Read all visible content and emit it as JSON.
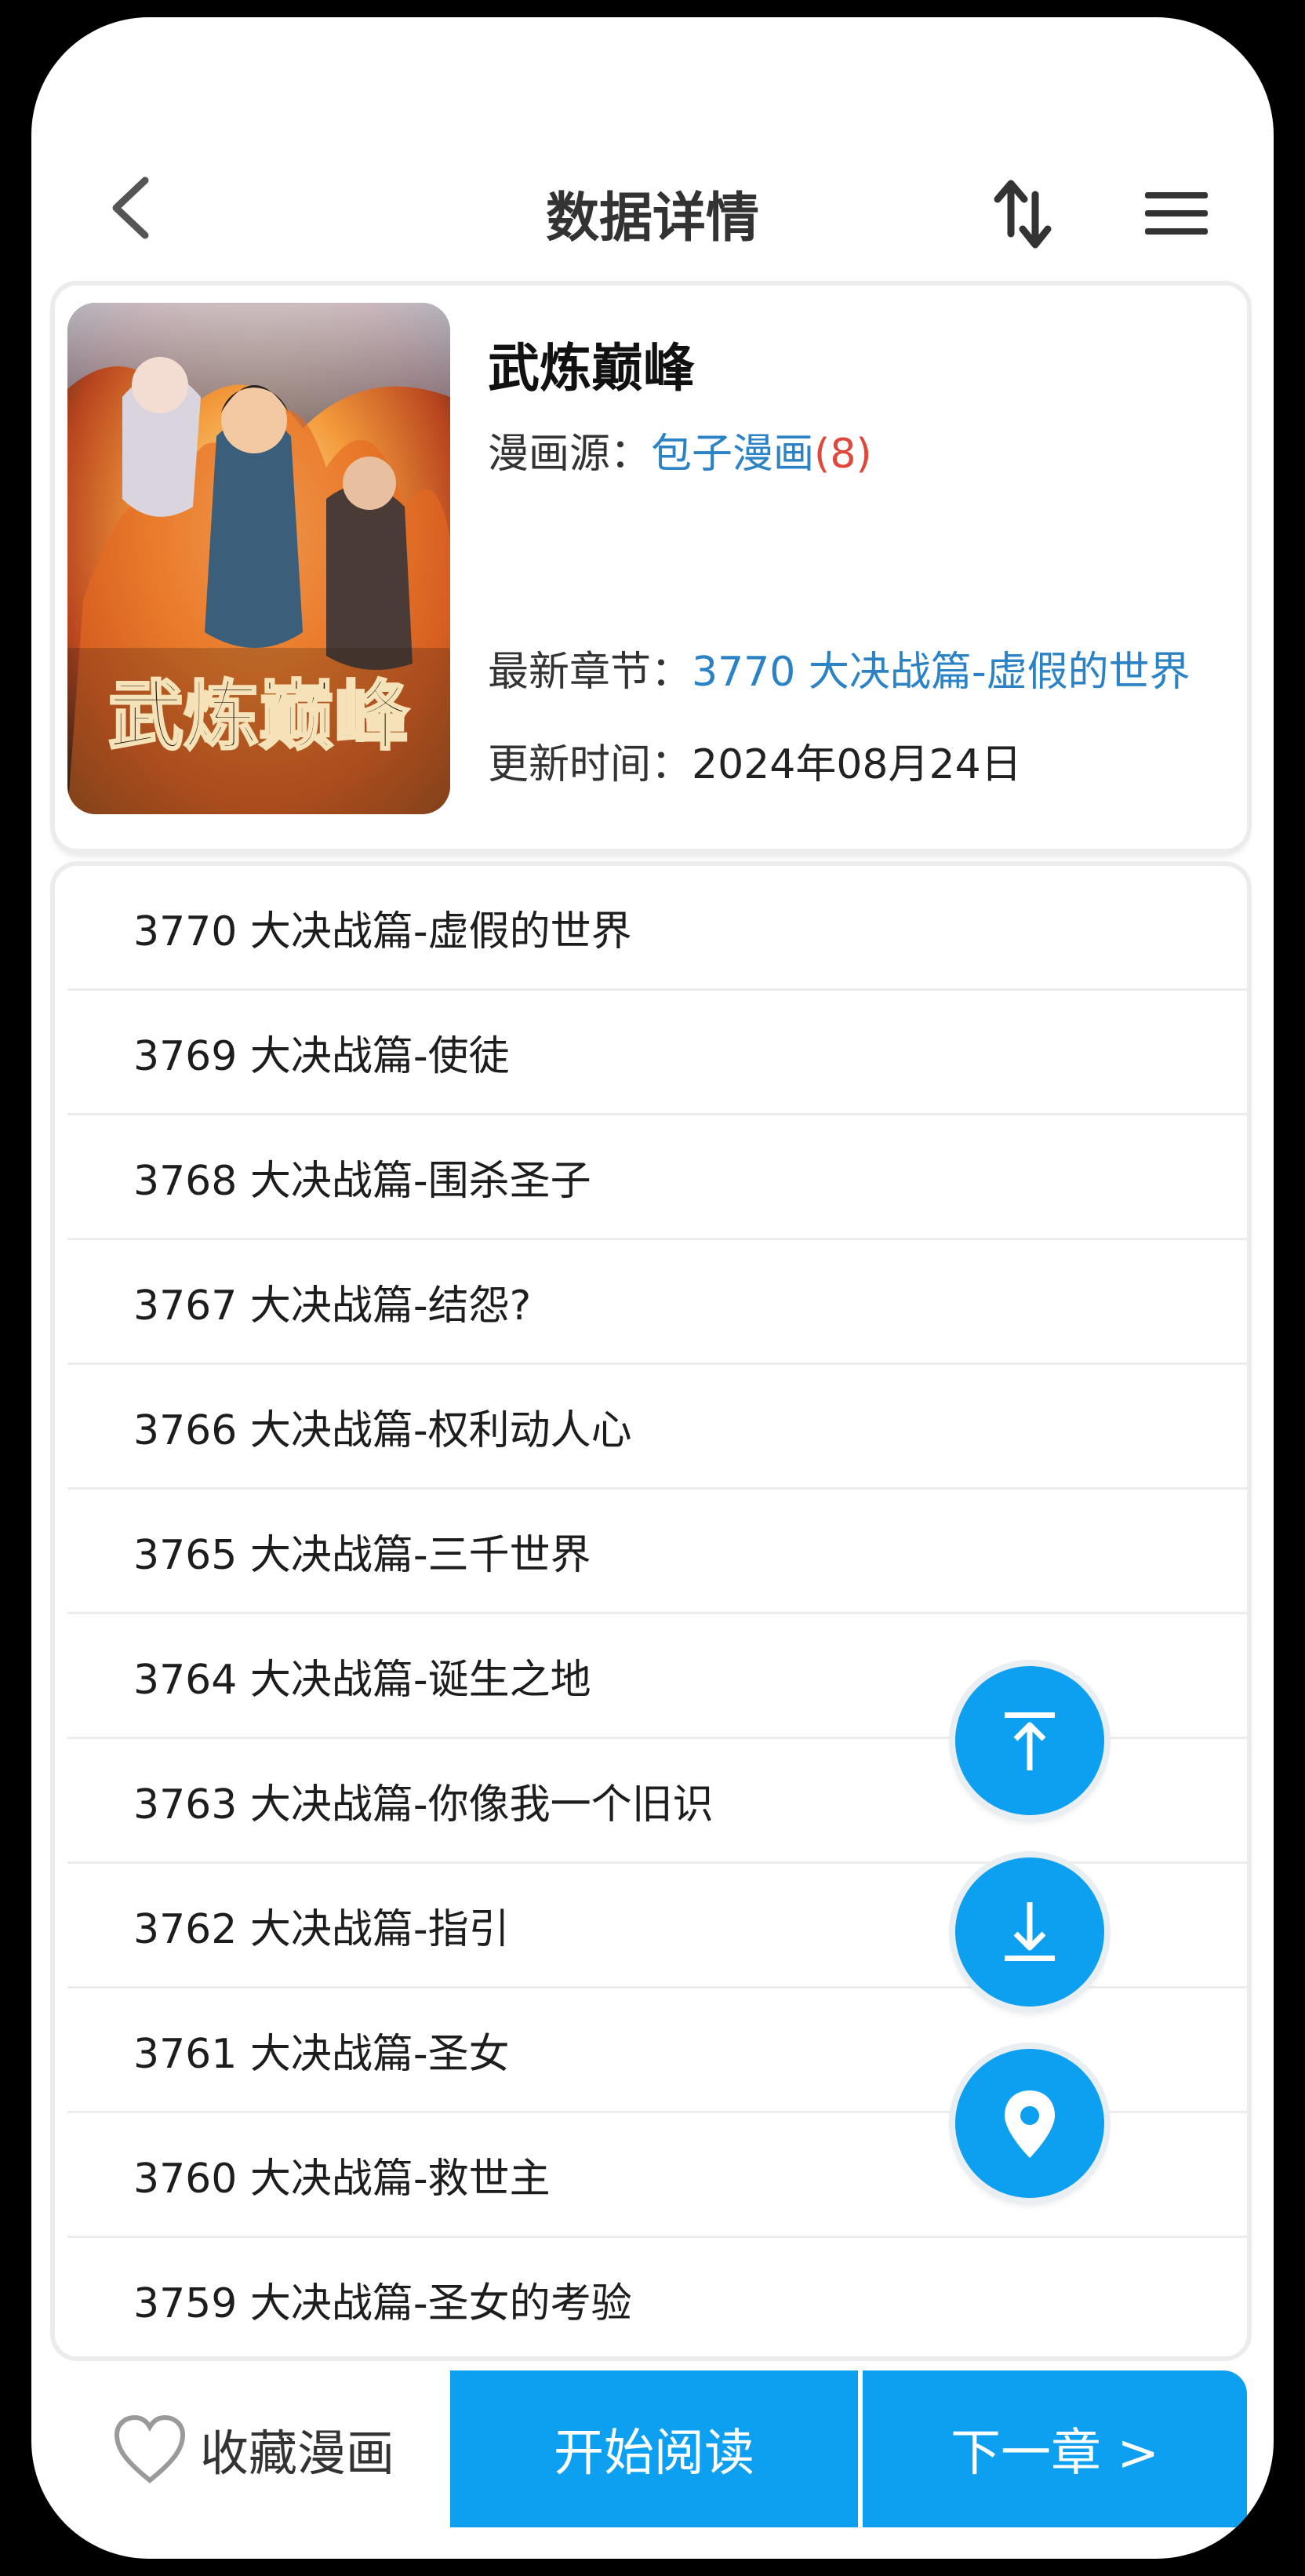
{
  "header": {
    "title": "数据详情",
    "back_icon": "chevron-left-icon",
    "sort_icon": "sort-arrows-icon",
    "menu_icon": "hamburger-menu-icon"
  },
  "info": {
    "name": "武炼巅峰",
    "cover_text": "武炼巅峰",
    "source_label": "漫画源：",
    "source_value": "包子漫画",
    "source_count": "(8)",
    "latest_label": "最新章节：",
    "latest_value": "3770 大决战篇-虚假的世界",
    "updated_label": "更新时间：",
    "updated_value": "2024年08月24日"
  },
  "chapters": [
    "3770 大决战篇-虚假的世界",
    "3769 大决战篇-使徒",
    "3768 大决战篇-围杀圣子",
    "3767 大决战篇-结怨?",
    "3766 大决战篇-权利动人心",
    "3765 大决战篇-三千世界",
    "3764 大决战篇-诞生之地",
    "3763 大决战篇-你像我一个旧识",
    "3762 大决战篇-指引",
    "3761 大决战篇-圣女",
    "3760 大决战篇-救世主",
    "3759 大决战篇-圣女的考验"
  ],
  "fabs": {
    "top_icon": "scroll-to-top-icon",
    "bottom_icon": "scroll-to-bottom-icon",
    "locate_icon": "location-pin-icon"
  },
  "bottom": {
    "favorite_label": "收藏漫画",
    "favorite_icon": "heart-outline-icon",
    "read_label": "开始阅读",
    "next_label": "下一章 >"
  },
  "colors": {
    "accent": "#0ea0f0",
    "link": "#2b82c4",
    "count": "#e0483e"
  }
}
